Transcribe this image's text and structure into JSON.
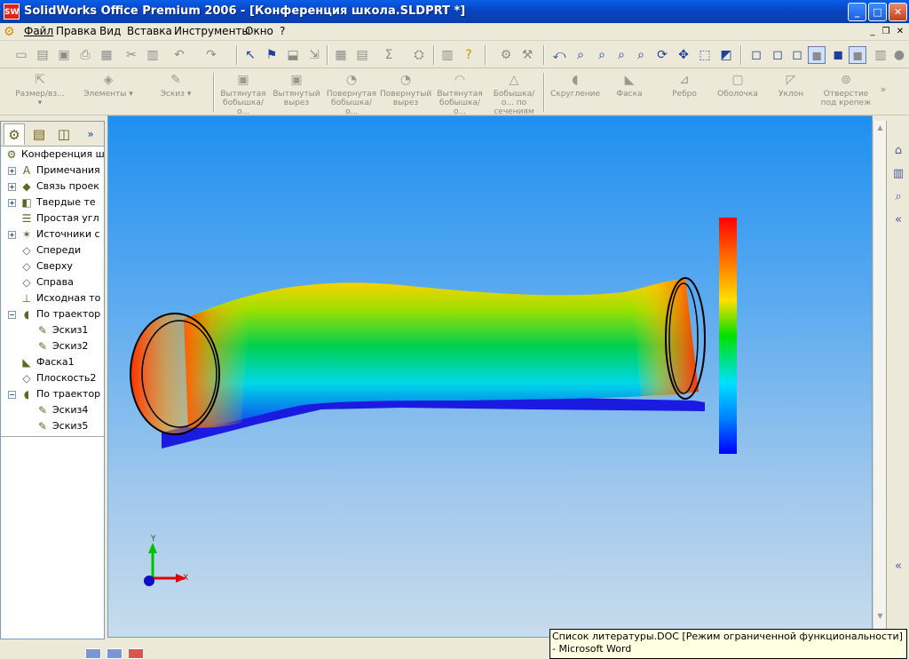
{
  "window": {
    "title": "SolidWorks Office Premium 2006 - [Конференция школа.SLDPRT *]",
    "icon_label": "SW"
  },
  "window_controls": {
    "minimize": "_",
    "maximize": "□",
    "close": "✕"
  },
  "menu": {
    "items": [
      "Файл",
      "Правка",
      "Вид",
      "Вставка",
      "Инструменты",
      "Окно",
      "?"
    ],
    "doc_controls": {
      "minimize": "_",
      "restore": "❐",
      "close": "✕"
    }
  },
  "feature_toolbar": {
    "items": [
      "Размер/вз...",
      "Элементы",
      "Эскиз",
      "Вытянутая бобышка/о...",
      "Вытянутый вырез",
      "Повернутая бобышка/о...",
      "Повернутый вырез",
      "Вытянутая бобышка/о...",
      "Бобышка/о... по сечениям",
      "Скругление",
      "Фаска",
      "Ребро",
      "Оболочка",
      "Уклон",
      "Отверстие под крепеж"
    ]
  },
  "feature_tree": {
    "root": "Конференция шк",
    "nodes": [
      {
        "label": "Примечания",
        "icon": "annotations-icon",
        "expander": "+"
      },
      {
        "label": "Связь проек",
        "icon": "link-icon",
        "expander": "+"
      },
      {
        "label": "Твердые те",
        "icon": "solid-bodies-icon",
        "expander": "+"
      },
      {
        "label": "Простая угл",
        "icon": "material-icon",
        "expander": ""
      },
      {
        "label": "Источники с",
        "icon": "lights-icon",
        "expander": "+"
      },
      {
        "label": "Спереди",
        "icon": "plane-icon",
        "expander": ""
      },
      {
        "label": "Сверху",
        "icon": "plane-icon",
        "expander": ""
      },
      {
        "label": "Справа",
        "icon": "plane-icon",
        "expander": ""
      },
      {
        "label": "Исходная то",
        "icon": "origin-icon",
        "expander": ""
      },
      {
        "label": "По траектор",
        "icon": "sweep-icon",
        "expander": "−"
      },
      {
        "label": "Эскиз1",
        "icon": "sketch-icon",
        "expander": ""
      },
      {
        "label": "Эскиз2",
        "icon": "sketch-icon",
        "expander": ""
      },
      {
        "label": "Фаска1",
        "icon": "chamfer-icon",
        "expander": ""
      },
      {
        "label": "Плоскость2",
        "icon": "plane-icon",
        "expander": ""
      },
      {
        "label": "По траектор",
        "icon": "sweep-icon",
        "expander": "−"
      },
      {
        "label": "Эскиз4",
        "icon": "sketch-icon",
        "expander": ""
      },
      {
        "label": "Эскиз5",
        "icon": "sketch-icon",
        "expander": ""
      }
    ]
  },
  "triad": {
    "x": "X",
    "y": "Y"
  },
  "tooltip": {
    "text": "Список литературы.DOC [Режим ограниченной функциональности] - Microsoft Word"
  },
  "colors": {
    "xp_blue": "#0a5ee6",
    "legend_top": "#ff0000",
    "legend_bottom": "#0000ff",
    "part_base": "#1a1ae0"
  }
}
